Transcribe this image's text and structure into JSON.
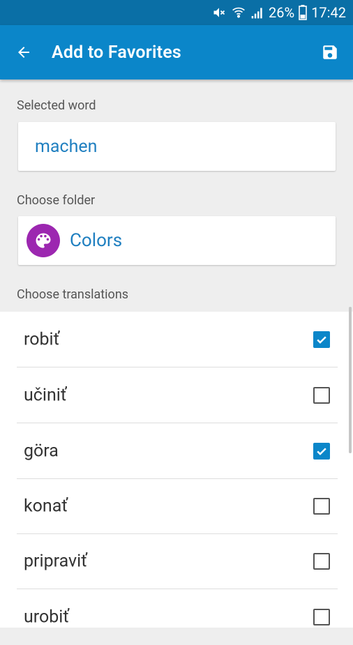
{
  "status_bar": {
    "battery_percent": "26%",
    "time": "17:42"
  },
  "app_bar": {
    "title": "Add to Favorites"
  },
  "selected_word": {
    "label": "Selected word",
    "value": "machen"
  },
  "folder": {
    "label": "Choose folder",
    "name": "Colors",
    "icon": "palette-icon",
    "icon_color": "#9c27b0"
  },
  "translations": {
    "label": "Choose translations",
    "items": [
      {
        "text": "robiť",
        "checked": true
      },
      {
        "text": "učiniť",
        "checked": false
      },
      {
        "text": "göra",
        "checked": true
      },
      {
        "text": "konať",
        "checked": false
      },
      {
        "text": "pripraviť",
        "checked": false
      },
      {
        "text": "urobiť",
        "checked": false
      }
    ]
  },
  "colors": {
    "status_bar": "#0a6fa6",
    "app_bar": "#0b86c9",
    "accent_text": "#1f7fc0"
  }
}
